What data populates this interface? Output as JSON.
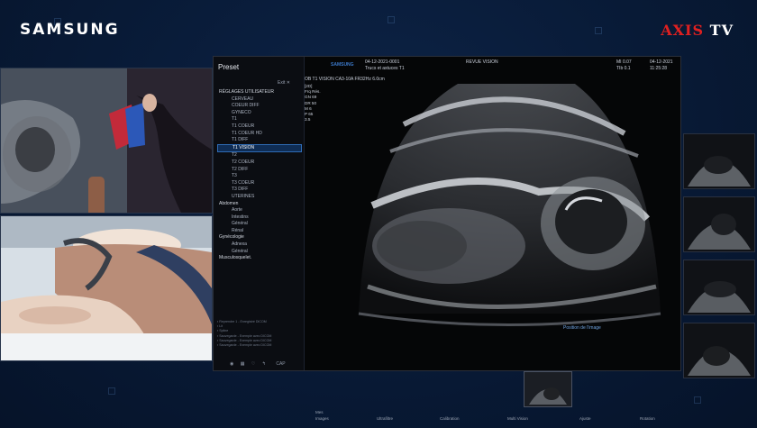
{
  "brand": {
    "left_logo": "SAMSUNG",
    "right_logo_a": "AXIS",
    "right_logo_b": "TV"
  },
  "preset": {
    "title": "Preset",
    "exit": "Exit  ✕",
    "items": [
      {
        "label": "RÉGLAGES UTILISATEUR",
        "kind": "grp"
      },
      {
        "label": "CERVEAU",
        "kind": "sub"
      },
      {
        "label": "COEUR DIFF",
        "kind": "sub"
      },
      {
        "label": "GYNECO",
        "kind": "sub"
      },
      {
        "label": "T1",
        "kind": "sub"
      },
      {
        "label": "T1 COEUR",
        "kind": "sub"
      },
      {
        "label": "T1 COEUR HD",
        "kind": "sub"
      },
      {
        "label": "T1 DIFF",
        "kind": "sub"
      },
      {
        "label": "T1 VISION",
        "kind": "sub sel"
      },
      {
        "label": "T2",
        "kind": "sub"
      },
      {
        "label": "T2 COEUR",
        "kind": "sub"
      },
      {
        "label": "T2 DIFF",
        "kind": "sub"
      },
      {
        "label": "T3",
        "kind": "sub"
      },
      {
        "label": "T3 COEUR",
        "kind": "sub"
      },
      {
        "label": "T3 DIFF",
        "kind": "sub"
      },
      {
        "label": "UTERINES",
        "kind": "sub"
      },
      {
        "label": "Abdomen",
        "kind": "grp"
      },
      {
        "label": "Aorte",
        "kind": "sub"
      },
      {
        "label": "Intestins",
        "kind": "sub"
      },
      {
        "label": "Général",
        "kind": "sub"
      },
      {
        "label": "Rénal",
        "kind": "sub"
      },
      {
        "label": "Gynécologie",
        "kind": "grp"
      },
      {
        "label": "Adnexa",
        "kind": "sub"
      },
      {
        "label": "Général",
        "kind": "sub"
      },
      {
        "label": "Musculosquelet.",
        "kind": "grp"
      }
    ],
    "bottom_label": "CAP"
  },
  "header": {
    "samsung_small": "SAMSUNG",
    "patient_id": "04-12-2021-0001",
    "patient_name": "Trucs et astuces T1",
    "mode": "REVUE VISION",
    "mi": "MI 0.07",
    "tib": "TIb 0.1",
    "date": "04-12-2021",
    "time": "11:25:28",
    "probe": "OB T1 VISION  CA3-10A  FR32Hz  6.0cm"
  },
  "params": [
    "[2D]",
    "Frq  Rés.",
    "GN   69",
    "DR   50",
    "M    6",
    "P    65",
    "3.5"
  ],
  "bottom_bar": {
    "center_label": "Position de l'image",
    "items": [
      "Mes",
      "Images",
      "Ultrafiltre",
      "Calibration",
      "Multi Vision",
      "Ajuste",
      "Rotation"
    ]
  },
  "colors": {
    "background": "#081a36",
    "screen": "#050607",
    "selection": "#2f6bb5"
  },
  "icons": [
    "samsung-logo",
    "axis-tv-logo",
    "folder-icon",
    "settings-icon"
  ]
}
